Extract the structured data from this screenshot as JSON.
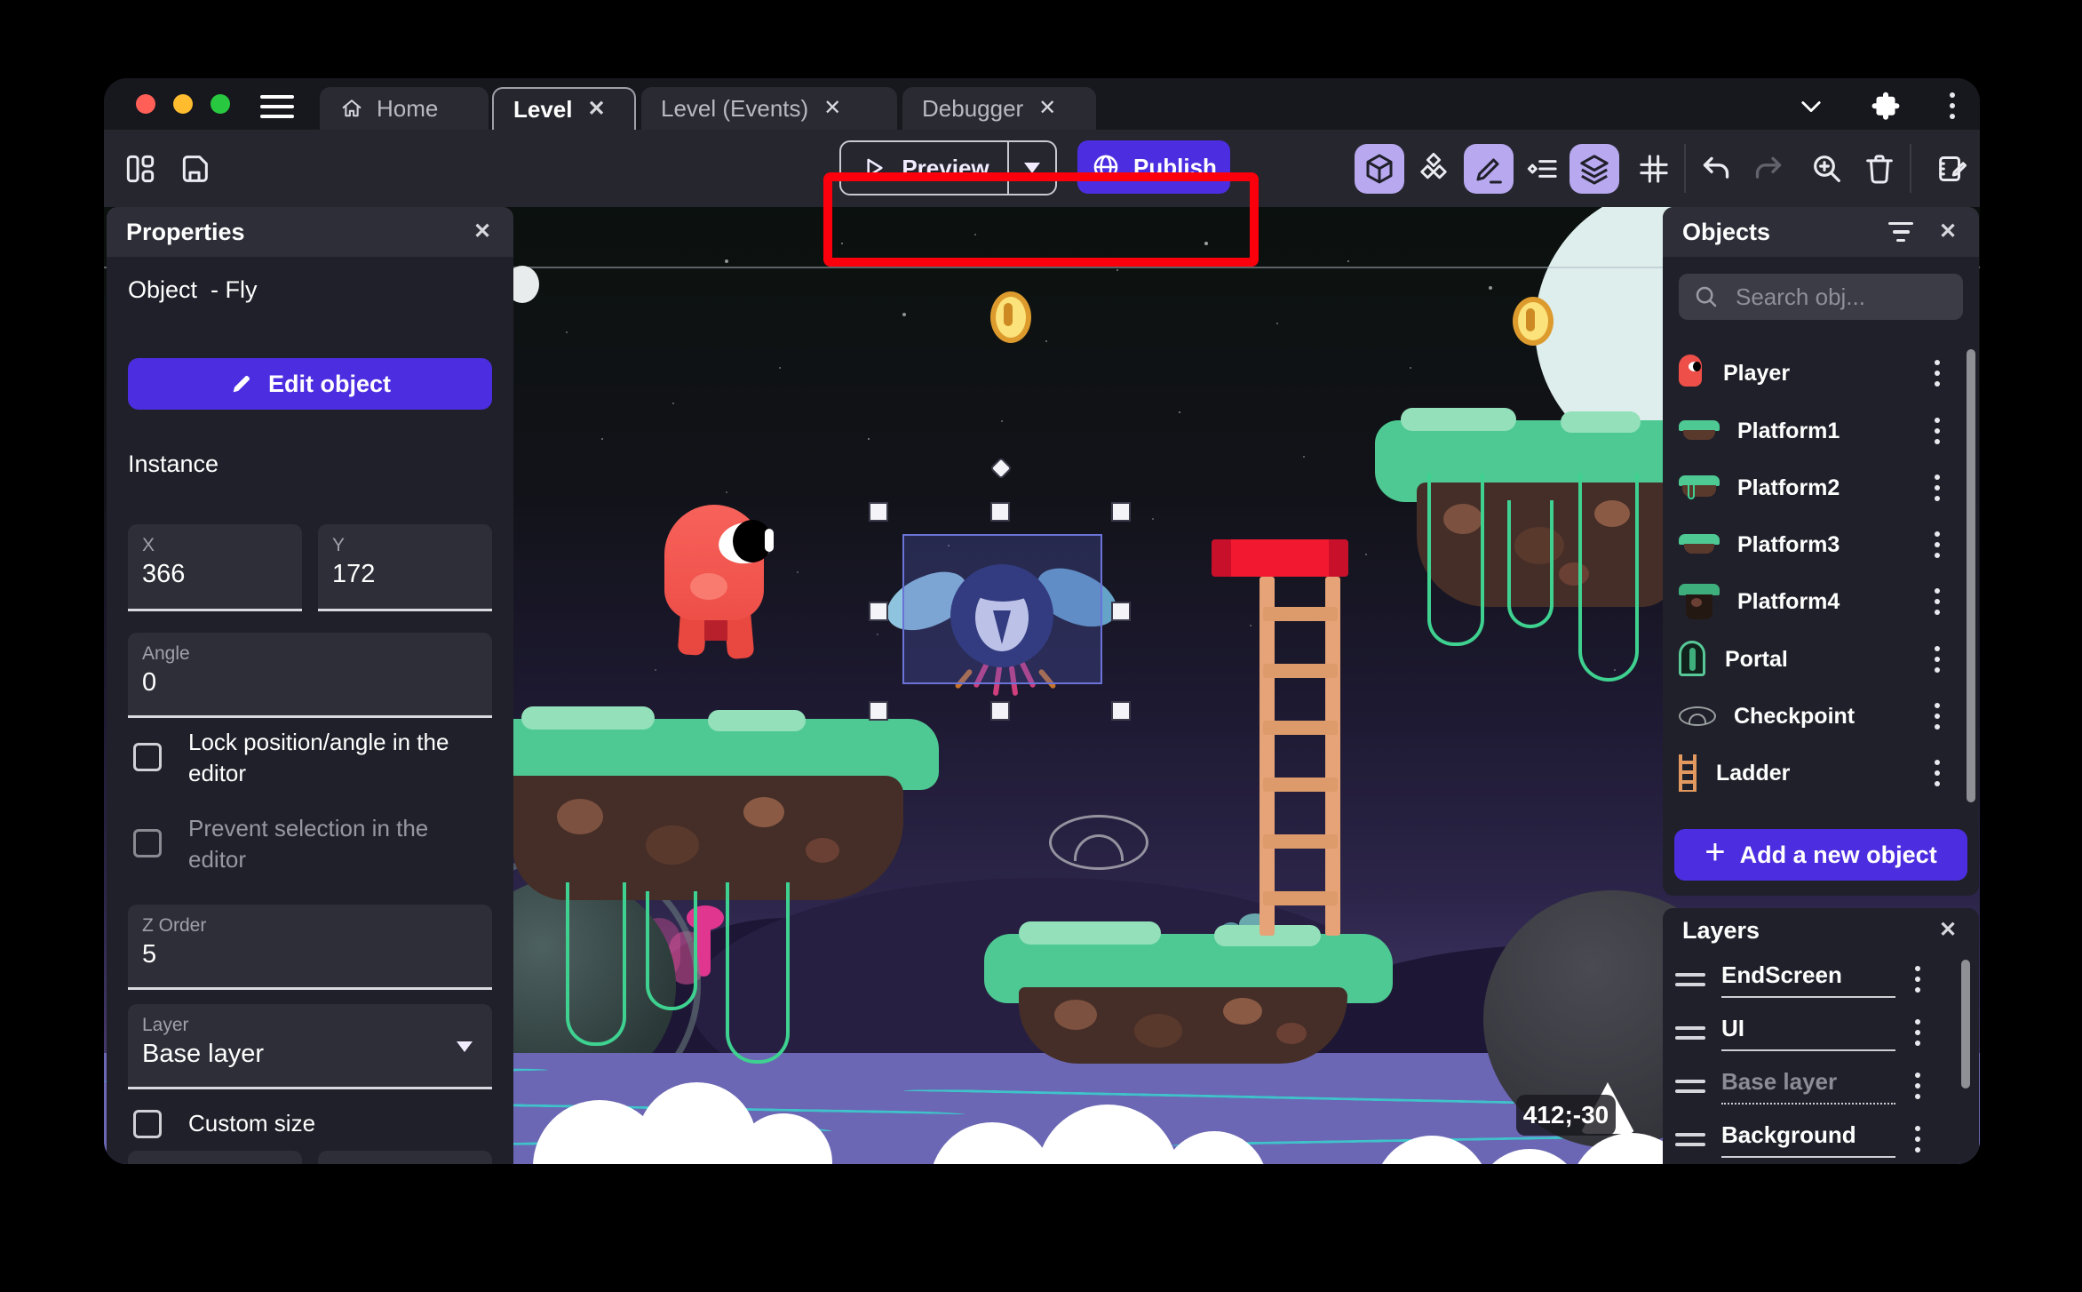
{
  "window": {
    "traffic_lights": [
      "close-light",
      "minimize-light",
      "zoom-light"
    ],
    "tabs": [
      {
        "label": "Home",
        "icon": "home-icon",
        "active": false,
        "closable": false
      },
      {
        "label": "Level",
        "active": true,
        "closable": true
      },
      {
        "label": "Level (Events)",
        "active": false,
        "closable": true
      },
      {
        "label": "Debugger",
        "active": false,
        "closable": true
      }
    ],
    "right_icons": [
      "chevron-down-icon",
      "extensions-puzzle-icon",
      "more-options-icon"
    ]
  },
  "toolbar": {
    "left_icons": [
      "panels-layout-icon",
      "save-icon"
    ],
    "preview_label": "Preview",
    "publish_label": "Publish",
    "right_icons": [
      "objects-cube-icon",
      "instances-cubes-icon",
      "properties-pencil-icon",
      "instances-list-icon",
      "layers-icon",
      "grid-icon",
      "undo-icon",
      "redo-icon",
      "zoom-in-icon",
      "trash-icon",
      "edit-scene-icon"
    ],
    "active_icons": [
      "objects-cube-icon",
      "properties-pencil-icon",
      "layers-icon"
    ]
  },
  "properties": {
    "title": "Properties",
    "object_heading": "Object  - Fly",
    "edit_button": "Edit object",
    "section_instance": "Instance",
    "x_label": "X",
    "x_value": "366",
    "y_label": "Y",
    "y_value": "172",
    "angle_label": "Angle",
    "angle_value": "0",
    "lock_label": "Lock position/angle in the editor",
    "prevent_label": "Prevent selection in the editor",
    "zorder_label": "Z Order",
    "zorder_value": "5",
    "layer_label": "Layer",
    "layer_value": "Base layer",
    "custom_size_label": "Custom size"
  },
  "objects": {
    "title": "Objects",
    "search_placeholder": "Search obj...",
    "items": [
      {
        "name": "Player",
        "icon": "player-icon"
      },
      {
        "name": "Platform1",
        "icon": "platform-icon"
      },
      {
        "name": "Platform2",
        "icon": "platform-icon"
      },
      {
        "name": "Platform3",
        "icon": "platform-icon"
      },
      {
        "name": "Platform4",
        "icon": "platform-dark-icon"
      },
      {
        "name": "Portal",
        "icon": "portal-icon"
      },
      {
        "name": "Checkpoint",
        "icon": "checkpoint-eye-icon"
      },
      {
        "name": "Ladder",
        "icon": "ladder-icon"
      }
    ],
    "add_button": "Add a new object"
  },
  "layers": {
    "title": "Layers",
    "items": [
      {
        "name": "EndScreen",
        "selected": false
      },
      {
        "name": "UI",
        "selected": false
      },
      {
        "name": "Base layer",
        "selected": true
      },
      {
        "name": "Background",
        "selected": false
      }
    ]
  },
  "canvas": {
    "coords_badge": "412;-30"
  },
  "colors": {
    "accent_purple": "#4c2ee0",
    "active_icon_bg": "#b7a8ef",
    "annotation_red": "#fb000c",
    "selection_blue": "#6a74d8",
    "grass_green": "#4ec993"
  }
}
